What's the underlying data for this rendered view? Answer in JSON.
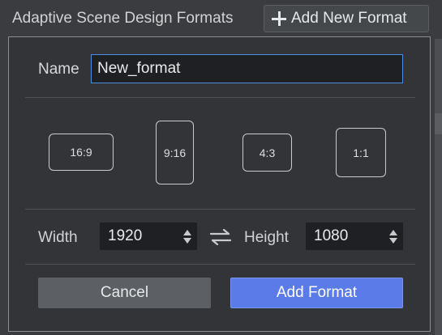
{
  "background": {
    "title": "Adaptive Scene Design Formats",
    "add_new_button": {
      "label": "Add New Format",
      "icon": "plus-icon"
    }
  },
  "dialog": {
    "name_label": "Name",
    "name_value": "New_format",
    "presets": [
      "16:9",
      "9:16",
      "4:3",
      "1:1"
    ],
    "width_label": "Width",
    "width_value": "1920",
    "height_label": "Height",
    "height_value": "1080",
    "swap_icon": "swap-arrows-icon",
    "cancel_label": "Cancel",
    "add_label": "Add Format"
  },
  "colors": {
    "accent": "#5b7be8",
    "focus_border": "#4a90e2",
    "dialog_bg": "#323437"
  }
}
